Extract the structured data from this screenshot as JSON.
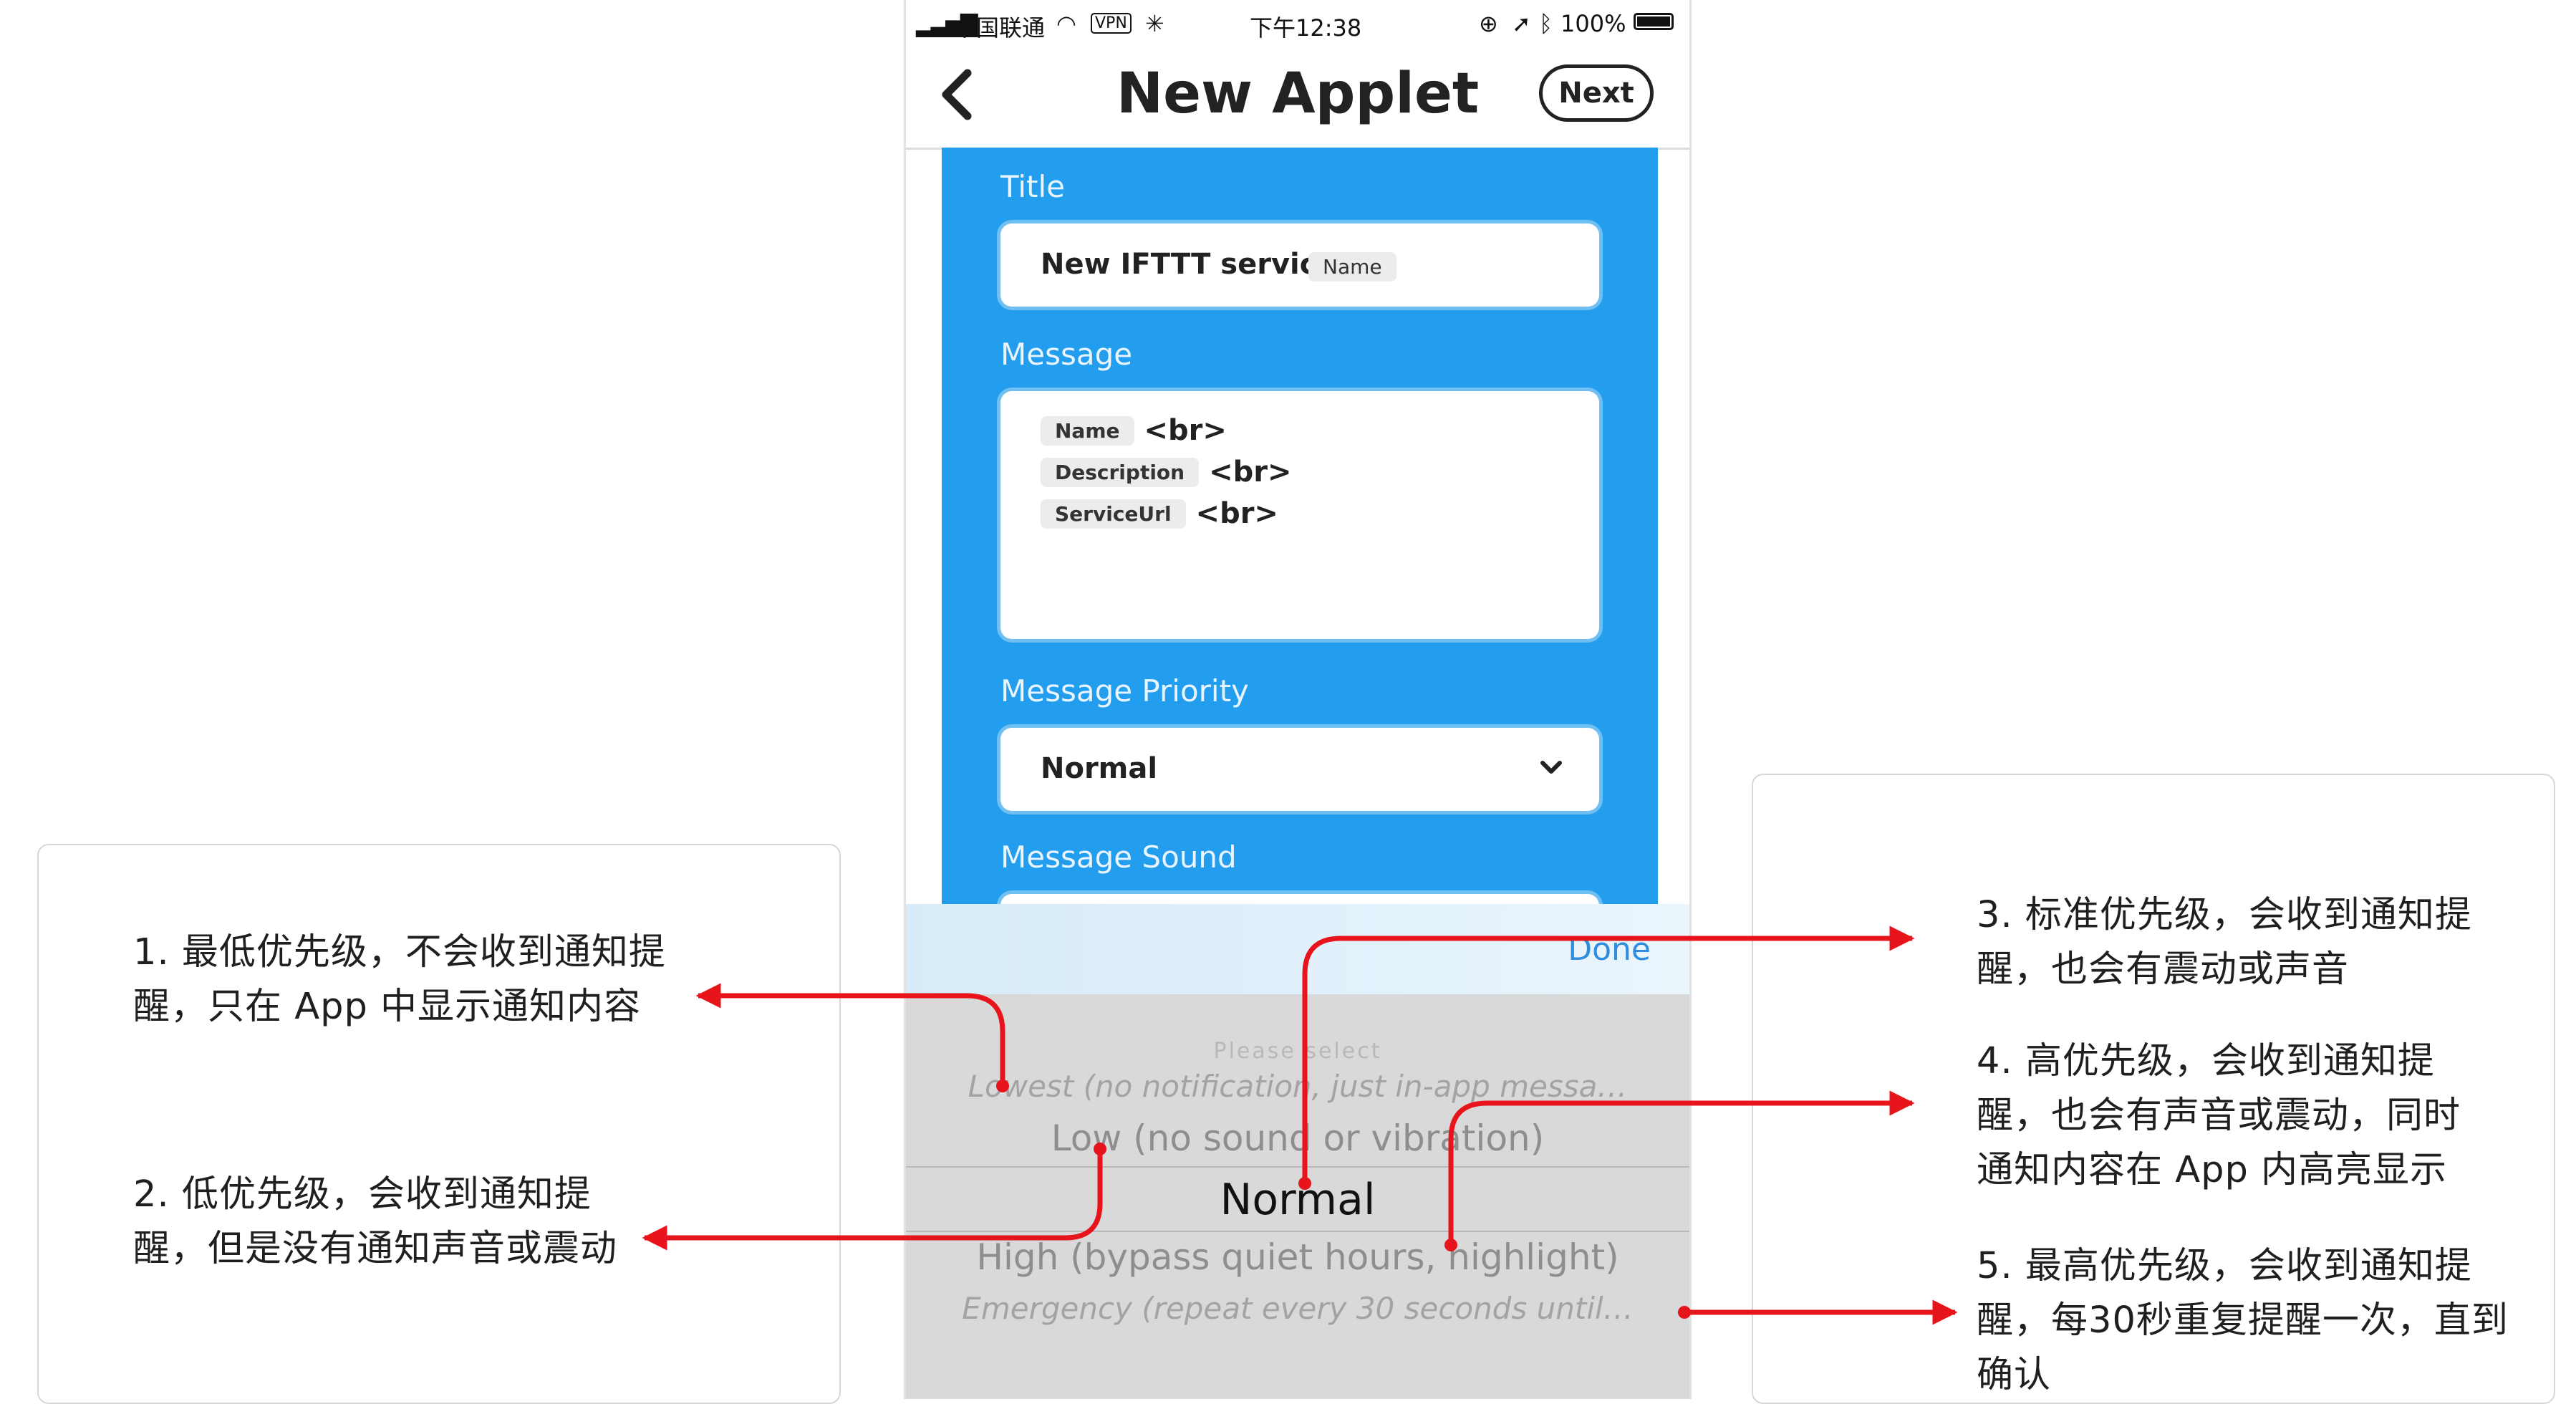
{
  "status_bar": {
    "carrier": "中国联通",
    "vpn": "VPN",
    "time": "下午12:38",
    "battery": "100%"
  },
  "nav": {
    "back_icon": "chevron-left-icon",
    "title": "New Applet",
    "next_label": "Next"
  },
  "form": {
    "title_label": "Title",
    "title_value": "New IFTTT service:",
    "title_chip": "Name",
    "message_label": "Message",
    "message_lines": [
      {
        "chip": "Name",
        "text": "<br>"
      },
      {
        "chip": "Description",
        "text": "<br>"
      },
      {
        "chip": "ServiceUrl",
        "text": "<br>"
      }
    ],
    "priority_label": "Message Priority",
    "priority_value": "Normal",
    "sound_label": "Message Sound"
  },
  "picker": {
    "done_label": "Done",
    "placeholder": "Please select",
    "options": [
      "Lowest (no notification, just in-app messa…",
      "Low (no sound or vibration)",
      "Normal",
      "High (bypass quiet hours, highlight)",
      "Emergency (repeat every 30 seconds until…"
    ],
    "selected": "Normal"
  },
  "notes": {
    "n1": [
      "1. 最低优先级，不会收到通知提",
      "醒，只在 App 中显示通知内容"
    ],
    "n2": [
      "2. 低优先级，会收到通知提",
      "醒，但是没有通知声音或震动"
    ],
    "n3": [
      "3. 标准优先级，会收到通知提",
      "醒，也会有震动或声音"
    ],
    "n4": [
      "4. 高优先级，会收到通知提",
      "醒，也会有声音或震动，同时",
      "通知内容在 App 内高亮显示"
    ],
    "n5": [
      "5. 最高优先级，会收到通知提",
      "醒，每30秒重复提醒一次，直到",
      "确认"
    ]
  },
  "colors": {
    "form_bg": "#239ded",
    "arrow": "#e8141c",
    "done": "#2f8de0"
  }
}
